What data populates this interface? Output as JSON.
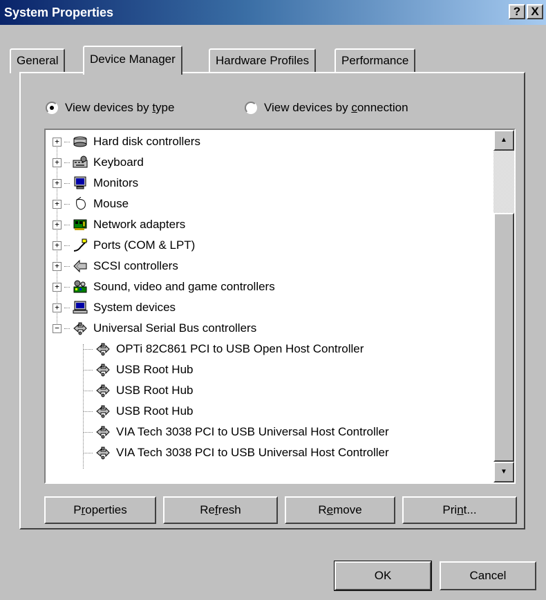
{
  "window": {
    "title": "System Properties",
    "help_btn": "?",
    "close_btn": "X"
  },
  "tabs": [
    {
      "label": "General",
      "active": false
    },
    {
      "label": "Device Manager",
      "active": true
    },
    {
      "label": "Hardware Profiles",
      "active": false
    },
    {
      "label": "Performance",
      "active": false
    }
  ],
  "view_options": [
    {
      "pre": "View devices by ",
      "accel": "t",
      "post": "ype",
      "checked": true
    },
    {
      "pre": "View devices by ",
      "accel": "c",
      "post": "onnection",
      "checked": false
    }
  ],
  "tree": {
    "categories": [
      {
        "label": "Hard disk controllers",
        "expander": "+",
        "icon": "hard-disk-controller-icon"
      },
      {
        "label": "Keyboard",
        "expander": "+",
        "icon": "keyboard-icon"
      },
      {
        "label": "Monitors",
        "expander": "+",
        "icon": "monitor-icon"
      },
      {
        "label": "Mouse",
        "expander": "+",
        "icon": "mouse-icon"
      },
      {
        "label": "Network adapters",
        "expander": "+",
        "icon": "network-adapter-icon"
      },
      {
        "label": "Ports (COM & LPT)",
        "expander": "+",
        "icon": "port-icon"
      },
      {
        "label": "SCSI controllers",
        "expander": "+",
        "icon": "scsi-icon"
      },
      {
        "label": "Sound, video and game controllers",
        "expander": "+",
        "icon": "sound-icon"
      },
      {
        "label": "System devices",
        "expander": "+",
        "icon": "system-device-icon"
      },
      {
        "label": "Universal Serial Bus controllers",
        "expander": "−",
        "icon": "usb-icon"
      }
    ],
    "usb_children": [
      "OPTi 82C861 PCI to USB Open Host Controller",
      "USB Root Hub",
      "USB Root Hub",
      "USB Root Hub",
      "VIA Tech 3038 PCI to USB Universal Host Controller",
      "VIA Tech 3038 PCI to USB Universal Host Controller"
    ]
  },
  "actions": [
    {
      "pre": "P",
      "accel": "r",
      "post": "operties"
    },
    {
      "pre": "Re",
      "accel": "f",
      "post": "resh"
    },
    {
      "pre": "R",
      "accel": "e",
      "post": "move"
    },
    {
      "pre": "Pri",
      "accel": "n",
      "post": "t..."
    }
  ],
  "dialog": {
    "ok_label": "OK",
    "cancel_label": "Cancel"
  },
  "colors": {
    "title_start": "#0a246a",
    "title_end": "#a6caf0",
    "face": "#c0c0c0"
  }
}
